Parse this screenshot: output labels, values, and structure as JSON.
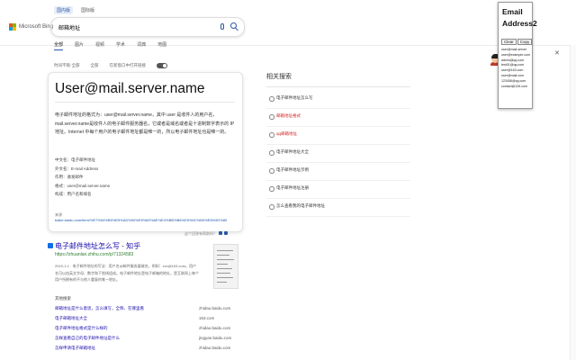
{
  "header": {
    "scope_tabs": [
      "国内版",
      "国际版"
    ],
    "logo_text": "Microsoft Bing",
    "query": "邮箱地址"
  },
  "nav": [
    "全部",
    "图片",
    "视频",
    "学术",
    "词典",
    "地图"
  ],
  "filters": {
    "time": "时间不限·全部",
    "region": "全部",
    "open_links": "在新窗口中打开链接"
  },
  "answer": {
    "title": "User@mail.server.name",
    "description": "电子邮件地址的格式为：user@mail.server.name，其中 user 是收件人的用户名，mail.server.name是收件人的电子邮件服务器名，它或者是域名或者是十进制数字表示的 IP 地址。Internet 中每个用户的电子邮件地址都是唯一的，所以电子邮件地址也是唯一的。",
    "attrs": [
      "中文名：电子邮件地址",
      "外文名：E-mail Address",
      "作用：收发邮件",
      "格式：user@mail.server.name",
      "构成：用户名和域名"
    ],
    "source_label": "来源",
    "source_url": "baike.baidu.com/item/%E7%94%B5%E5%AD%90%E9%82%AE%E4%BB%B6%E5%9C%B0%E5%9D%80"
  },
  "feedback_label": "这个回答有帮助吗？",
  "result": {
    "title": "电子邮件地址怎么写 - 知乎",
    "url": "https://zhuanlan.zhihu.com/p/71324583",
    "snippet": "2019-1-1 · 电子邮件地址的写法：用户名@邮件服务器域名。例如：xxx@163.com。用户名可以由英文字母、数字和下划线组成。电子邮件地址是电子邮箱的地址，是互联网上每个用户所拥有的不与他人重复的唯一地址。"
  },
  "links_head": "其他搜索",
  "links": [
    {
      "text": "邮箱地址是什么意思，怎么填写，全称、在哪里看",
      "domain": "zhidao.baidu.com"
    },
    {
      "text": "电子邮箱地址大全",
      "domain": "163.com"
    },
    {
      "text": "电子邮件地址格式是什么样的",
      "domain": "zhidao.baidu.com"
    },
    {
      "text": "怎样查看自己的电子邮件地址是什么",
      "domain": "jingyan.baidu.com"
    },
    {
      "text": "怎样申请电子邮箱地址",
      "domain": "zhidao.baidu.com"
    }
  ],
  "related": {
    "title": "相关搜索",
    "items": [
      "电子邮件地址怎么写",
      "邮箱地址格式",
      "qq邮箱地址",
      "电子邮件地址大全",
      "电子邮件地址示例",
      "电子邮件地址注册",
      "怎么查看我的电子邮件地址"
    ]
  },
  "extension": {
    "title": "Email Address2",
    "clear_label": "Clear",
    "copy_label": "Copy",
    "emails": [
      "user@mail.server",
      "user@example.com",
      "admin@qq.com",
      "test01@qq.com",
      "user@163.com",
      "user@mail.com",
      "123456@qq.com",
      "contact@126.com"
    ]
  },
  "colors": {
    "link": "#1a0dab",
    "accent": "#2b57a6",
    "url_green": "#2e7d32",
    "related_red": "#d21f1f"
  }
}
